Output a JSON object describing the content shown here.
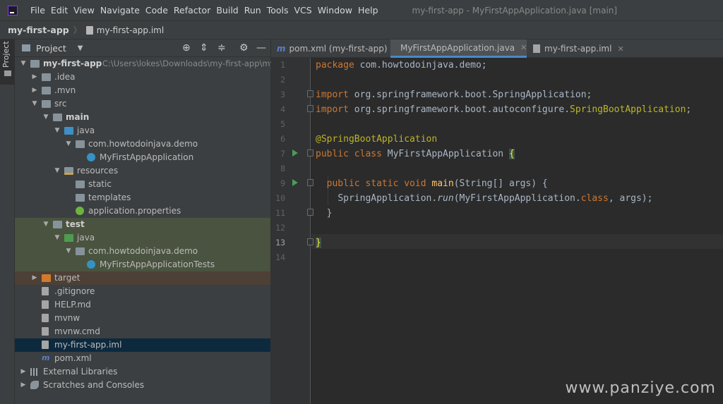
{
  "menubar": {
    "items": [
      "File",
      "Edit",
      "View",
      "Navigate",
      "Code",
      "Refactor",
      "Build",
      "Run",
      "Tools",
      "VCS",
      "Window",
      "Help"
    ],
    "window_title": "my-first-app - MyFirstAppApplication.java [main]"
  },
  "navbar": {
    "project": "my-first-app",
    "file": "my-first-app.iml"
  },
  "tool_stripe": {
    "label": "Project"
  },
  "project_panel": {
    "title": "Project",
    "tree": [
      {
        "label": "my-first-app",
        "path": "C:\\Users\\lokes\\Downloads\\my-first-app\\my-fi",
        "icon": "folder",
        "arrow": "down",
        "bold": true
      },
      {
        "label": ".idea",
        "icon": "folder",
        "arrow": "right"
      },
      {
        "label": ".mvn",
        "icon": "folder",
        "arrow": "right"
      },
      {
        "label": "src",
        "icon": "folder",
        "arrow": "down"
      },
      {
        "label": "main",
        "icon": "folder",
        "arrow": "down",
        "bold": true
      },
      {
        "label": "java",
        "icon": "folder-blue",
        "arrow": "down"
      },
      {
        "label": "com.howtodoinjava.demo",
        "icon": "pkg",
        "arrow": "down"
      },
      {
        "label": "MyFirstAppApplication",
        "icon": "class",
        "arrow": ""
      },
      {
        "label": "resources",
        "icon": "folder-res",
        "arrow": "down"
      },
      {
        "label": "static",
        "icon": "folder",
        "arrow": ""
      },
      {
        "label": "templates",
        "icon": "folder",
        "arrow": ""
      },
      {
        "label": "application.properties",
        "icon": "spring",
        "arrow": ""
      },
      {
        "label": "test",
        "icon": "folder",
        "arrow": "down",
        "bold": true
      },
      {
        "label": "java",
        "icon": "folder-green",
        "arrow": "down"
      },
      {
        "label": "com.howtodoinjava.demo",
        "icon": "pkg",
        "arrow": "down"
      },
      {
        "label": "MyFirstAppApplicationTests",
        "icon": "class",
        "arrow": ""
      },
      {
        "label": "target",
        "icon": "folder-orange",
        "arrow": "right"
      },
      {
        "label": ".gitignore",
        "icon": "file",
        "arrow": ""
      },
      {
        "label": "HELP.md",
        "icon": "file",
        "arrow": ""
      },
      {
        "label": "mvnw",
        "icon": "file",
        "arrow": ""
      },
      {
        "label": "mvnw.cmd",
        "icon": "file",
        "arrow": ""
      },
      {
        "label": "my-first-app.iml",
        "icon": "file",
        "arrow": "",
        "selected": true
      },
      {
        "label": "pom.xml",
        "icon": "maven",
        "arrow": ""
      },
      {
        "label": "External Libraries",
        "icon": "lib",
        "arrow": "right"
      },
      {
        "label": "Scratches and Consoles",
        "icon": "scratch",
        "arrow": "right"
      }
    ]
  },
  "tabs": [
    {
      "label": "pom.xml (my-first-app)",
      "icon": "maven"
    },
    {
      "label": "MyFirstAppApplication.java",
      "icon": "class",
      "active": true
    },
    {
      "label": "my-first-app.iml",
      "icon": "file"
    }
  ],
  "editor": {
    "current_line": 13,
    "lines": [
      "1",
      "2",
      "3",
      "4",
      "5",
      "6",
      "7",
      "8",
      "9",
      "10",
      "11",
      "12",
      "13",
      "14"
    ],
    "code": {
      "l1_kw": "package",
      "l1_rest": " com.howtodoinjava.demo;",
      "l3_kw": "import",
      "l3_rest": " org.springframework.boot.SpringApplication;",
      "l4_kw": "import",
      "l4_rest": " org.springframework.boot.autoconfigure.",
      "l4_ann": "SpringBootApplication",
      "l4_end": ";",
      "l6_ann": "@SpringBootApplication",
      "l7_kw": "public class",
      "l7_name": " MyFirstAppApplication ",
      "l7_brace": "{",
      "l9_kw": "public static void",
      "l9_fn": "main",
      "l9_rest": "(String[] args) {",
      "l10_a": "SpringApplication.",
      "l10_run": "run",
      "l10_b": "(MyFirstAppApplication.",
      "l10_class": "class",
      "l10_c": ", args);",
      "l11": "}",
      "l13": "}"
    }
  },
  "watermark": "www.panziye.com"
}
